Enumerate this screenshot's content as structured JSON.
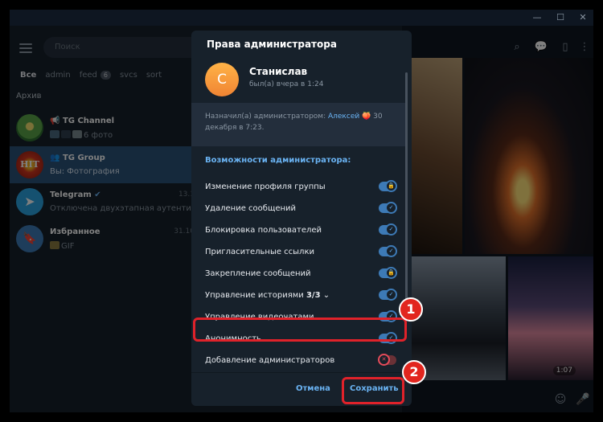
{
  "search": {
    "placeholder": "Поиск"
  },
  "folders": [
    {
      "label": "Все"
    },
    {
      "label": "admin"
    },
    {
      "label": "feed",
      "count": "6"
    },
    {
      "label": "svcs"
    },
    {
      "label": "sort"
    }
  ],
  "archive_label": "Архив",
  "chats": [
    {
      "name": "TG Channel",
      "message": "6 фото",
      "time": ""
    },
    {
      "name": "TG Group",
      "message": "Вы:  Фотография",
      "time": ""
    },
    {
      "name": "Telegram",
      "message": "Отключена двухэтапная аутентиф",
      "time": "13.1"
    },
    {
      "name": "Избранное",
      "message": "GIF",
      "time": "31.10"
    }
  ],
  "media": {
    "duration": "1:07"
  },
  "dialog": {
    "title": "Права администратора",
    "user": {
      "initial": "С",
      "name": "Станислав",
      "status": "был(а) вчера в 1:24"
    },
    "assigned_prefix": "Назначил(а) администратором:",
    "assigned_by": "Алексей",
    "assigned_date": "30 декабря в 7:23.",
    "section_title": "Возможности администратора:",
    "permissions": [
      {
        "label": "Изменение профиля группы",
        "enabled": true,
        "icon": "lock-icon"
      },
      {
        "label": "Удаление сообщений",
        "enabled": true,
        "icon": "check-icon"
      },
      {
        "label": "Блокировка пользователей",
        "enabled": true,
        "icon": "check-icon"
      },
      {
        "label": "Пригласительные ссылки",
        "enabled": true,
        "icon": "check-icon"
      },
      {
        "label": "Закрепление сообщений",
        "enabled": true,
        "icon": "lock-icon"
      },
      {
        "label": "Управление историями",
        "count": "3/3",
        "enabled": true,
        "icon": "check-icon"
      },
      {
        "label": "Управление видеочатами",
        "enabled": true,
        "icon": "check-icon"
      },
      {
        "label": "Анонимность",
        "enabled": true,
        "icon": "check-icon"
      },
      {
        "label": "Добавление администраторов",
        "enabled": false,
        "icon": "close-icon"
      }
    ],
    "cancel_label": "Отмена",
    "save_label": "Сохранить"
  },
  "callouts": [
    {
      "number": "1"
    },
    {
      "number": "2"
    }
  ],
  "colors": {
    "accent": "#6ab3f3",
    "selected_chat": "#2b5278",
    "callout": "#e0222a",
    "toggle_on": "#3d7ab6",
    "toggle_off": "#e54b5a"
  }
}
